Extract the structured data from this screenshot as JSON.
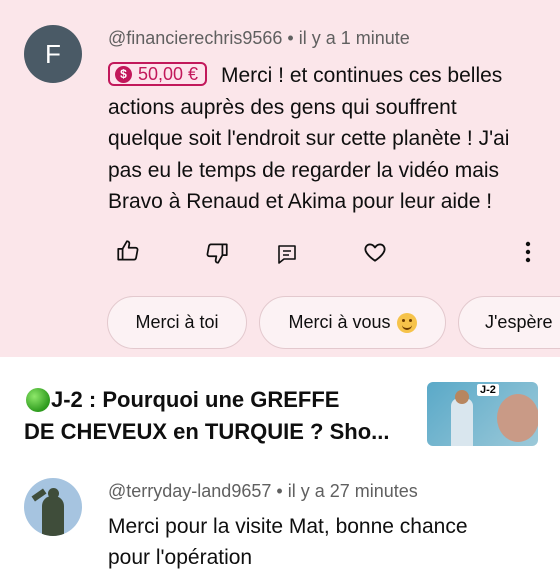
{
  "comment1": {
    "avatar_letter": "F",
    "author": "@financierechris9566",
    "separator": "•",
    "time": "il y a 1 minute",
    "superchat_amount": "50,00 €",
    "text_lines": [
      "Merci ! et continues ces belles",
      "actions auprès des gens qui souffrent",
      "quelque soit l'endroit sur cette planète ! J'ai",
      "pas eu le temps de regarder la vidéo mais",
      "Bravo à Renaud et Akima pour leur aide !"
    ],
    "actions": [
      "thumb-up-icon",
      "thumb-down-icon",
      "reply-icon",
      "heart-icon",
      "more-vert-icon"
    ]
  },
  "reply_suggestions": [
    "Merci à toi",
    "Merci à vous",
    "J'espère"
  ],
  "video": {
    "title_line1": "J-2 : Pourquoi une GREFFE",
    "title_line2": "DE CHEVEUX en TURQUIE ? Sho...",
    "thumbnail_tag": "J-2"
  },
  "comment2": {
    "author": "@terryday-land9657",
    "separator": "•",
    "time": "il y a 27 minutes",
    "text_lines": [
      "Merci pour la visite Mat, bonne chance",
      "pour l'opération"
    ]
  },
  "colors": {
    "highlight_bg": "#fbe6ea",
    "superchat": "#c2185b",
    "text": "#0f0f0f",
    "meta": "#606060"
  }
}
